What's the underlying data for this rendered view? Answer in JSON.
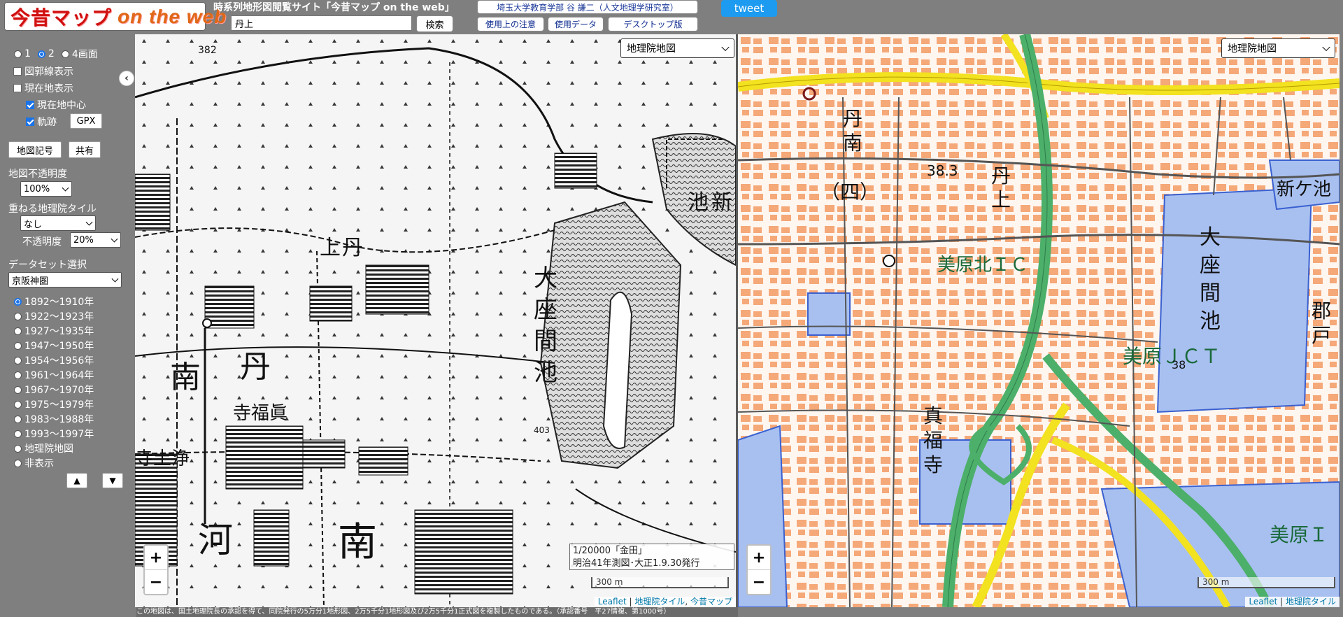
{
  "header": {
    "logo_jp": "今昔マップ",
    "logo_en": "on the web",
    "site_title": "時系列地形図閲覧サイト「今昔マップ on the web」",
    "search_value": "丹上",
    "search_button": "検索",
    "author": "埼玉大学教育学部 谷 謙二（人文地理学研究室）",
    "caution": "使用上の注意",
    "data": "使用データ",
    "desktop": "デスクトップ版",
    "tweet": "tweet"
  },
  "sidebar": {
    "collapse": "‹",
    "screens": [
      "1",
      "2",
      "4画面"
    ],
    "selected_screen": "2",
    "grid_label": "図郭線表示",
    "location_label": "現在地表示",
    "center_label": "現在地中心",
    "track_label": "軌跡",
    "gpx": "GPX",
    "legend_btn": "地図記号",
    "share_btn": "共有",
    "opacity_label": "地図不透明度",
    "opacity_value": "100%",
    "overlay_label": "重ねる地理院タイル",
    "overlay_value": "なし",
    "overlay_opacity_label": "不透明度",
    "overlay_opacity_value": "20%",
    "dataset_label": "データセット選択",
    "dataset_value": "京阪神圏",
    "years": [
      "1892～1910年",
      "1922～1923年",
      "1927～1935年",
      "1947～1950年",
      "1954～1956年",
      "1961～1964年",
      "1967～1970年",
      "1975～1979年",
      "1983～1988年",
      "1993～1997年",
      "地理院地図",
      "非表示"
    ],
    "selected_year": "1892～1910年",
    "up": "▲",
    "down": "▼"
  },
  "left_map": {
    "layer": "地理院地図",
    "caption_line1": "1/20000「金田」",
    "caption_line2": "明治41年測図･大正1.9.30発行",
    "scale": "300 m",
    "attr_leaflet": "Leaflet",
    "attr_gsi": "地理院タイル",
    "attr_konjaku": "今昔マップ",
    "labels": {
      "a": "382",
      "b": "上",
      "c": "丹",
      "d": "南",
      "e": "丹",
      "f": "寺福眞",
      "g": "寺土浄",
      "h": "河",
      "i": "南",
      "j": "大",
      "k": "座",
      "l": "間",
      "m": "池",
      "n": "新",
      "o": "池",
      "p": "403"
    }
  },
  "right_map": {
    "layer": "地理院地図",
    "scale": "300 m",
    "attr_leaflet": "Leaflet",
    "attr_gsi": "地理院タイル",
    "labels": {
      "a": "丹",
      "b": "南",
      "c": "（四）",
      "d": "38.3",
      "e": "丹",
      "f": "上",
      "g": "美原北ＩＣ",
      "h": "大",
      "i": "座",
      "j": "間",
      "k": "池",
      "l": "新ケ池",
      "m": "郡",
      "n": "戸",
      "o": "美原ＪＣＴ",
      "p": "38",
      "q": "真",
      "r": "福",
      "s": "寺",
      "t": "美原Ｉ"
    }
  },
  "zoom": {
    "in": "+",
    "out": "−"
  },
  "footer_note": "この地図は、国土地理院長の承認を得て、同院発行の5万分1地形図、2万5千分1地形図及び2万5千分1正式図を複製したものである。（承認番号　平27情複、第1000号）",
  "colors": {
    "sidebar_bg": "#7f7f7f",
    "tweet": "#1d9bf0",
    "expressway_green": "#4caf6a",
    "highway_yellow": "#f2e21f",
    "water": "#a8c0f0",
    "building": "#f0a070"
  }
}
